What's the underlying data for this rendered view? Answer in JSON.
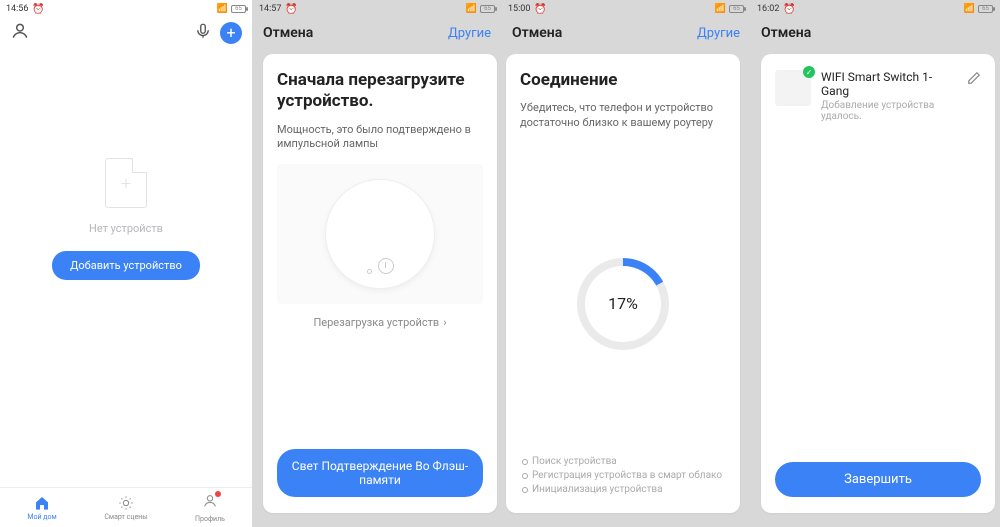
{
  "screen1": {
    "status_time": "14:56",
    "battery": "65",
    "no_devices": "Нет устройств",
    "add_device": "Добавить устройство",
    "tabs": {
      "home": "Мой дом",
      "smart": "Смарт сцены",
      "profile": "Профиль"
    }
  },
  "screen2": {
    "status_time": "14:57",
    "battery": "65",
    "cancel": "Отмена",
    "other": "Другие",
    "title": "Сначала перезагрузите устройство.",
    "subtitle": "Мощность, это было подтверждено в импульсной лампы",
    "link": "Перезагрузка устройств",
    "button": "Свет Подтверждение Во Флэш-памяти"
  },
  "screen3": {
    "status_time": "15:00",
    "battery": "65",
    "cancel": "Отмена",
    "other": "Другие",
    "title": "Соединение",
    "subtitle": "Убедитесь, что телефон и устройство достаточно близко к вашему роутеру",
    "progress": "17%",
    "steps": [
      "Поиск устройства",
      "Регистрация устройства в смарт облако",
      "Инициализация устройства"
    ]
  },
  "screen4": {
    "status_time": "16:02",
    "battery": "65",
    "cancel": "Отмена",
    "device_name": "WIFI Smart Switch 1-Gang",
    "device_sub": "Добавление устройства удалось.",
    "done": "Завершить"
  }
}
